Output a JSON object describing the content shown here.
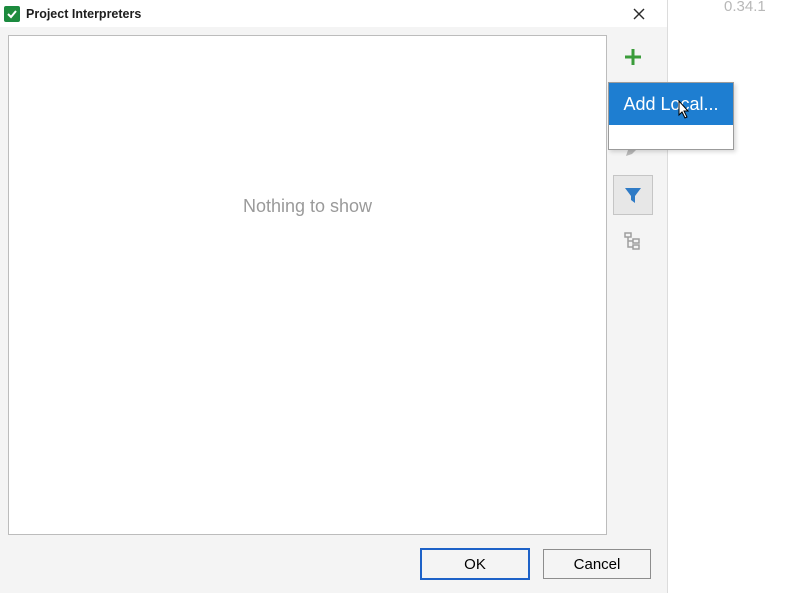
{
  "window": {
    "title": "Project Interpreters"
  },
  "listbox": {
    "empty_message": "Nothing to show"
  },
  "toolbar": {
    "add": "add-icon",
    "edit": "edit-icon",
    "filter": "filter-icon",
    "tree": "tree-icon"
  },
  "popup": {
    "add_local": "Add Local..."
  },
  "buttons": {
    "ok": "OK",
    "cancel": "Cancel"
  },
  "external": {
    "time_fragment": "0.34.1"
  }
}
